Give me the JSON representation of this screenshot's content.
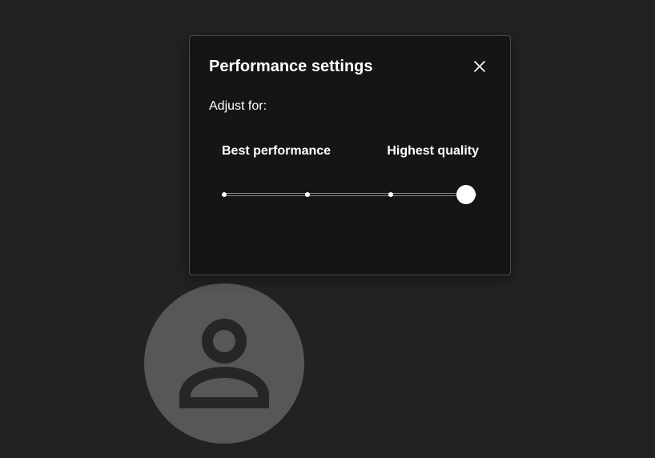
{
  "background": {
    "avatar_icon": "person-icon",
    "avatar_color": "#575757"
  },
  "dialog": {
    "title": "Performance settings",
    "close_icon": "close-icon",
    "adjust_label": "Adjust for:",
    "slider": {
      "min_label": "Best performance",
      "max_label": "Highest quality",
      "steps": 4,
      "selected_step": 4
    }
  }
}
